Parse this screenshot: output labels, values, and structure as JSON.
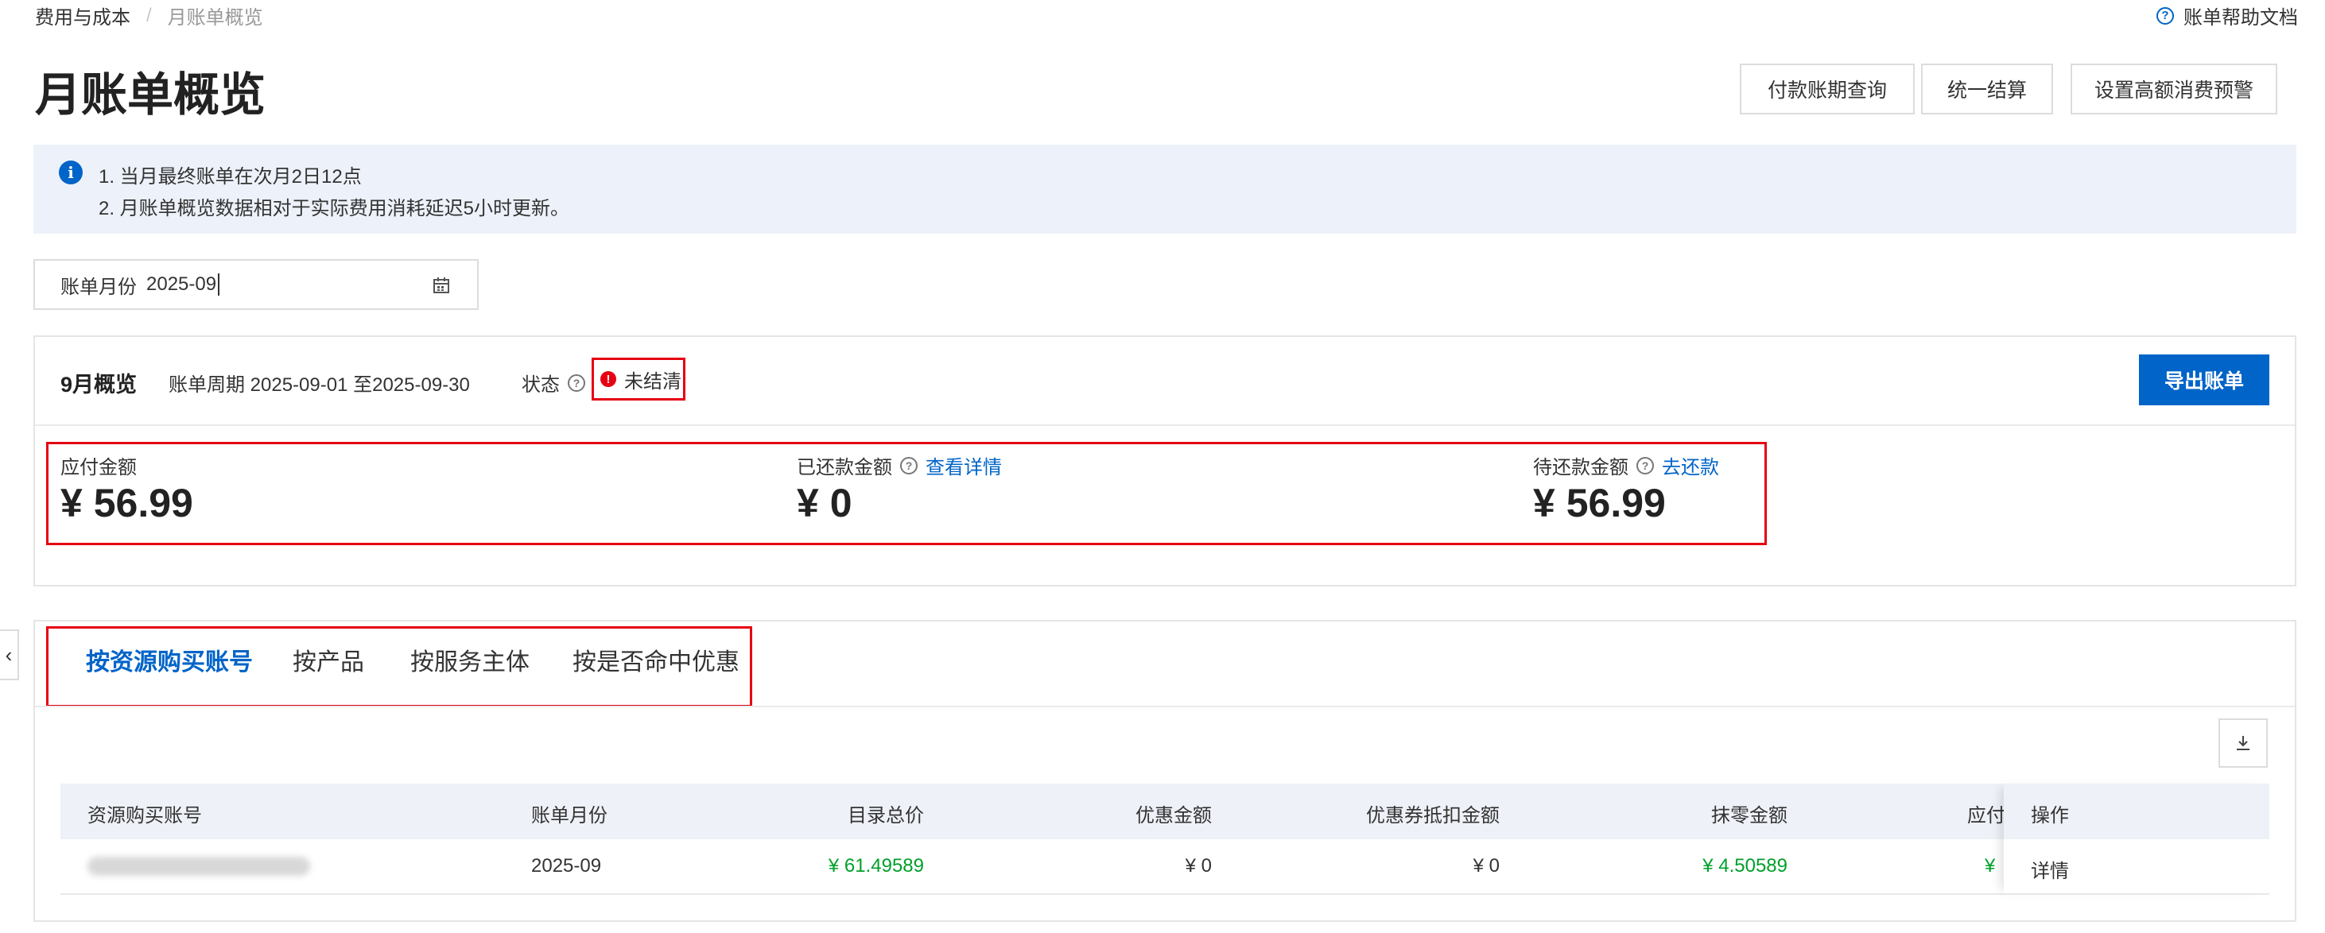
{
  "breadcrumb": {
    "parent": "费用与成本",
    "separator": "/",
    "current": "月账单概览"
  },
  "help": {
    "label": "账单帮助文档"
  },
  "page": {
    "title": "月账单概览"
  },
  "toolbar": {
    "payment_query": "付款账期查询",
    "unified_settle": "统一结算",
    "high_spend_alert": "设置高额消费预警"
  },
  "notice": {
    "line1": "1. 当月最终账单在次月2日12点",
    "line2": "2. 月账单概览数据相对于实际费用消耗延迟5小时更新。"
  },
  "month_picker": {
    "label": "账单月份",
    "value": "2025-09"
  },
  "overview": {
    "title": "9月概览",
    "period": "账单周期 2025-09-01 至2025-09-30",
    "status_label": "状态",
    "status_value": "未结清",
    "export_button": "导出账单",
    "payable_label": "应付金额",
    "payable_amount": "¥ 56.99",
    "paid_label": "已还款金额",
    "paid_link": "查看详情",
    "paid_amount": "¥ 0",
    "due_label": "待还款金额",
    "due_link": "去还款",
    "due_amount": "¥ 56.99"
  },
  "tabs": [
    {
      "label": "按资源购买账号",
      "active": true
    },
    {
      "label": "按产品",
      "active": false
    },
    {
      "label": "按服务主体",
      "active": false
    },
    {
      "label": "按是否命中优惠",
      "active": false
    }
  ],
  "table": {
    "headers": {
      "account": "资源购买账号",
      "month": "账单月份",
      "list_price": "目录总价",
      "discount": "优惠金额",
      "coupon": "优惠券抵扣金额",
      "rounding": "抹零金额",
      "payable": "应付",
      "action": "操作"
    },
    "rows": [
      {
        "month": "2025-09",
        "list_price": "¥ 61.49589",
        "discount": "¥ 0",
        "coupon": "¥ 0",
        "rounding": "¥ 4.50589",
        "payable": "¥",
        "action": "详情"
      }
    ]
  },
  "colors": {
    "accent": "#0064c8",
    "highlight": "#e60012",
    "positive": "#00a02a",
    "notice_bg": "#edf1f9"
  },
  "icons": [
    "help-circle-icon",
    "info-icon",
    "calendar-icon",
    "exclamation-circle-icon",
    "chevron-left-icon",
    "download-icon"
  ]
}
